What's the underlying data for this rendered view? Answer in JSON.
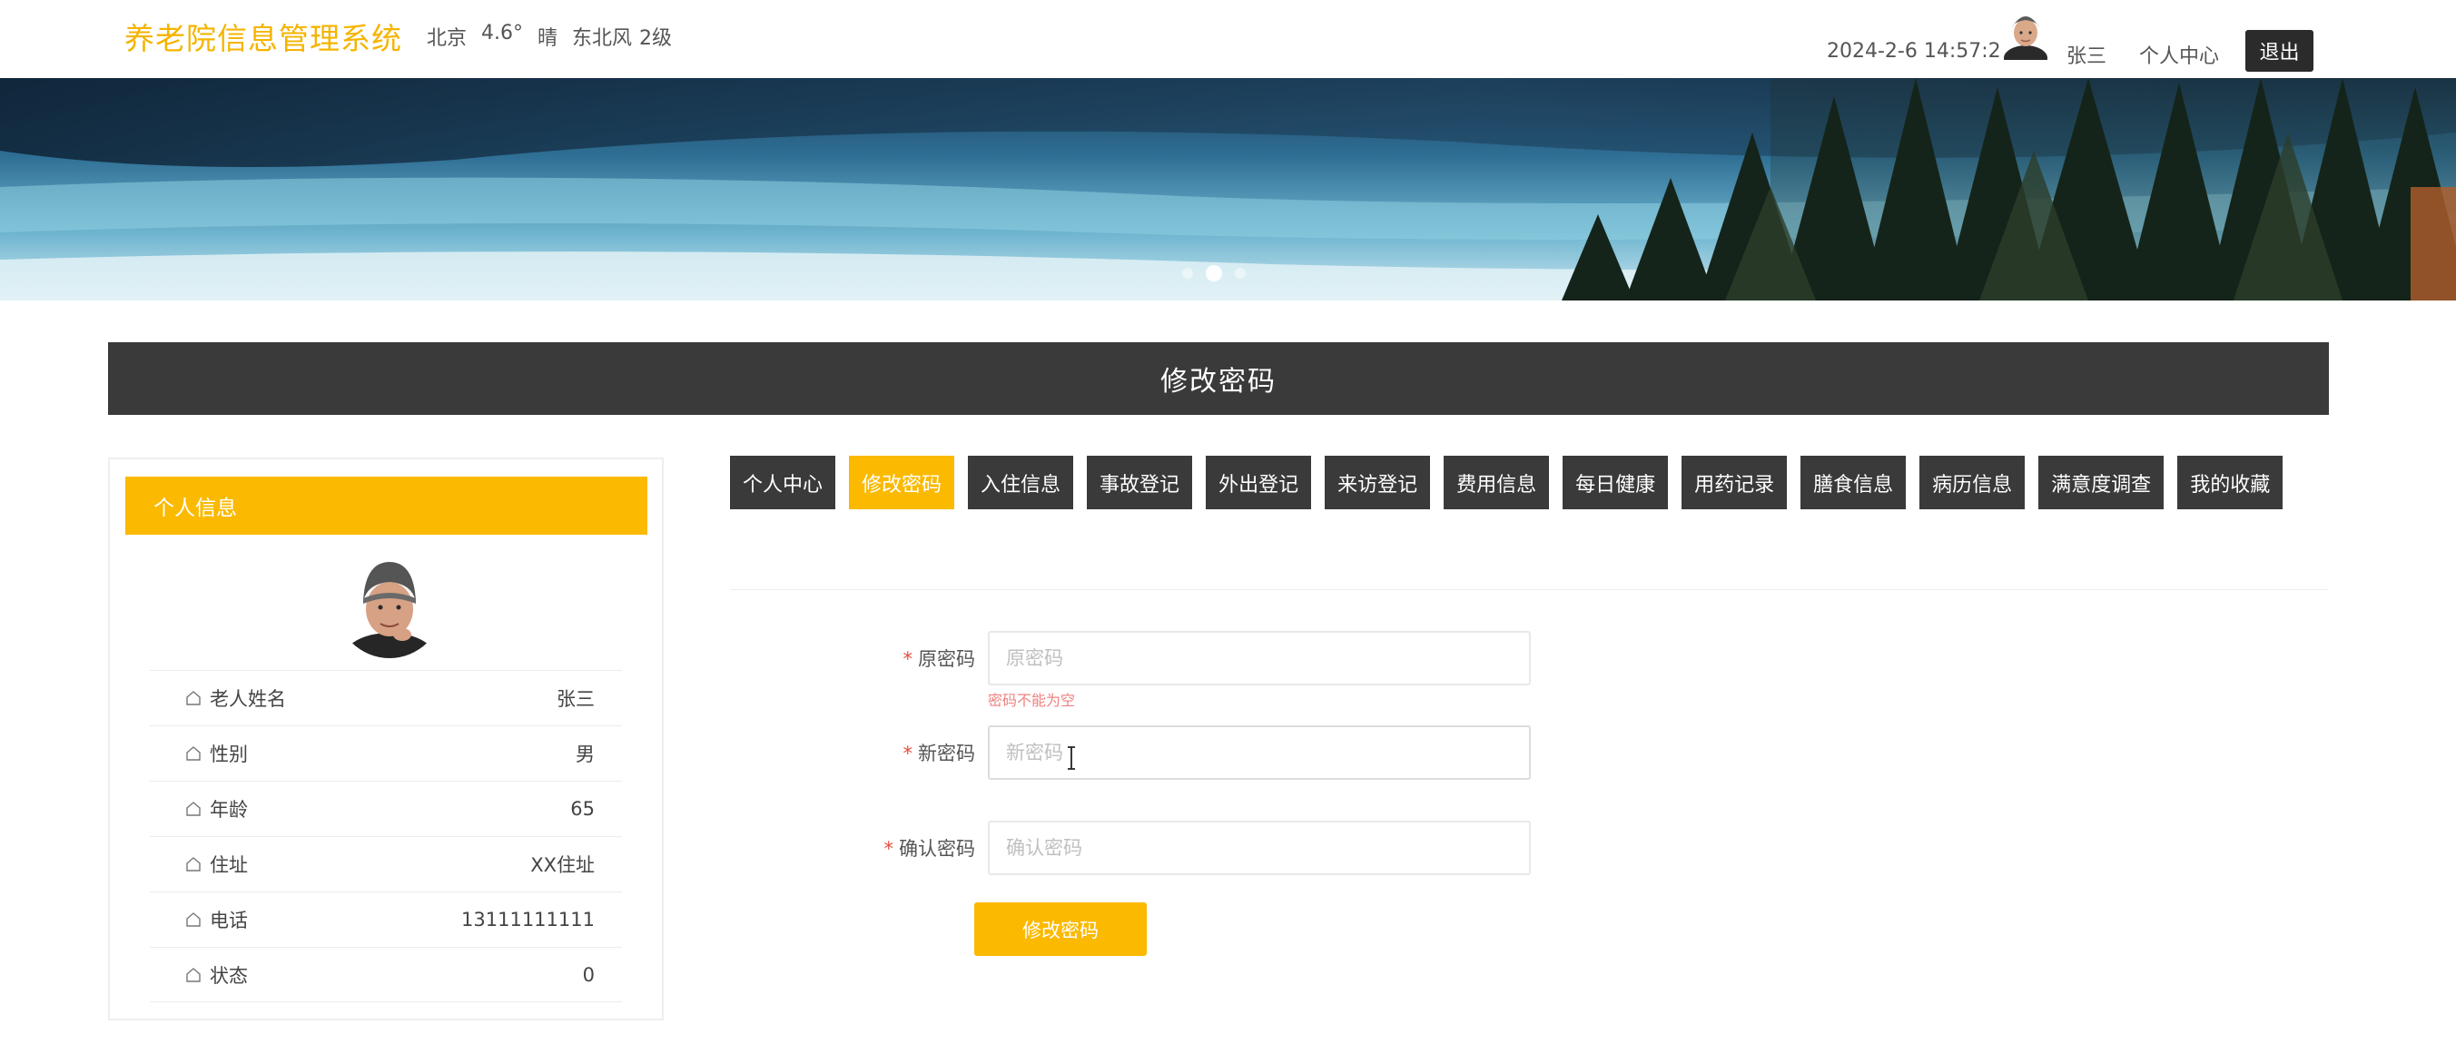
{
  "header": {
    "site_title": "养老院信息管理系统",
    "weather": {
      "city": "北京",
      "temperature": "4.6°",
      "condition": "晴",
      "wind": "东北风",
      "wind_level": "2级"
    },
    "datetime": "2024-2-6 14:57:29",
    "user_name": "张三",
    "personal_center": "个人中心",
    "logout": "退出"
  },
  "banner": {
    "slides": 3,
    "active_slide": 2
  },
  "page_title": "修改密码",
  "profile": {
    "heading": "个人信息",
    "rows": [
      {
        "label": "老人姓名",
        "value": "张三"
      },
      {
        "label": "性别",
        "value": "男"
      },
      {
        "label": "年龄",
        "value": "65"
      },
      {
        "label": "住址",
        "value": "XX住址"
      },
      {
        "label": "电话",
        "value": "13111111111"
      },
      {
        "label": "状态",
        "value": "0"
      }
    ]
  },
  "tabs": [
    {
      "label": "个人中心",
      "active": false
    },
    {
      "label": "修改密码",
      "active": true
    },
    {
      "label": "入住信息",
      "active": false
    },
    {
      "label": "事故登记",
      "active": false
    },
    {
      "label": "外出登记",
      "active": false
    },
    {
      "label": "来访登记",
      "active": false
    },
    {
      "label": "费用信息",
      "active": false
    },
    {
      "label": "每日健康",
      "active": false
    },
    {
      "label": "用药记录",
      "active": false
    },
    {
      "label": "膳食信息",
      "active": false
    },
    {
      "label": "病历信息",
      "active": false
    },
    {
      "label": "满意度调查",
      "active": false
    },
    {
      "label": "我的收藏",
      "active": false
    }
  ],
  "form": {
    "old_password": {
      "label": "原密码",
      "placeholder": "原密码",
      "value": "",
      "error": "密码不能为空"
    },
    "new_password": {
      "label": "新密码",
      "placeholder": "新密码",
      "value": ""
    },
    "confirm_password": {
      "label": "确认密码",
      "placeholder": "确认密码",
      "value": ""
    },
    "submit": "修改密码"
  },
  "colors": {
    "accent": "#fbb900",
    "dark": "#3a3a3a",
    "error": "#f08080"
  }
}
